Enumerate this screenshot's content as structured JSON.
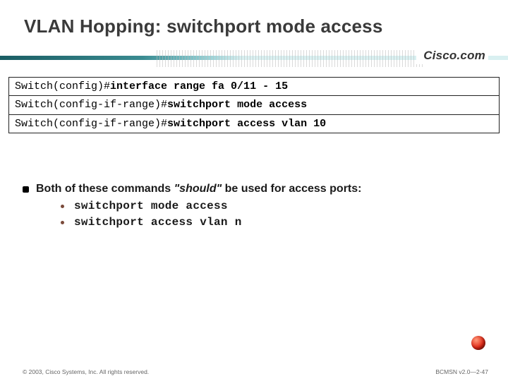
{
  "title": "VLAN Hopping: switchport mode access",
  "logo": "Cisco.com",
  "terminal": [
    {
      "prompt": "Switch(config)#",
      "cmd": "interface range fa 0/11 - 15"
    },
    {
      "prompt": "Switch(config-if-range)#",
      "cmd": "switchport mode access"
    },
    {
      "prompt": "Switch(config-if-range)#",
      "cmd": "switchport access vlan 10"
    }
  ],
  "bullet_pre": "Both of these commands ",
  "bullet_em": "\"should\"",
  "bullet_post": " be used for access ports:",
  "sub": [
    "switchport mode access",
    "switchport access vlan n"
  ],
  "footer_left": "© 2003, Cisco Systems, Inc. All rights reserved.",
  "footer_right": "BCMSN v2.0—2-47"
}
